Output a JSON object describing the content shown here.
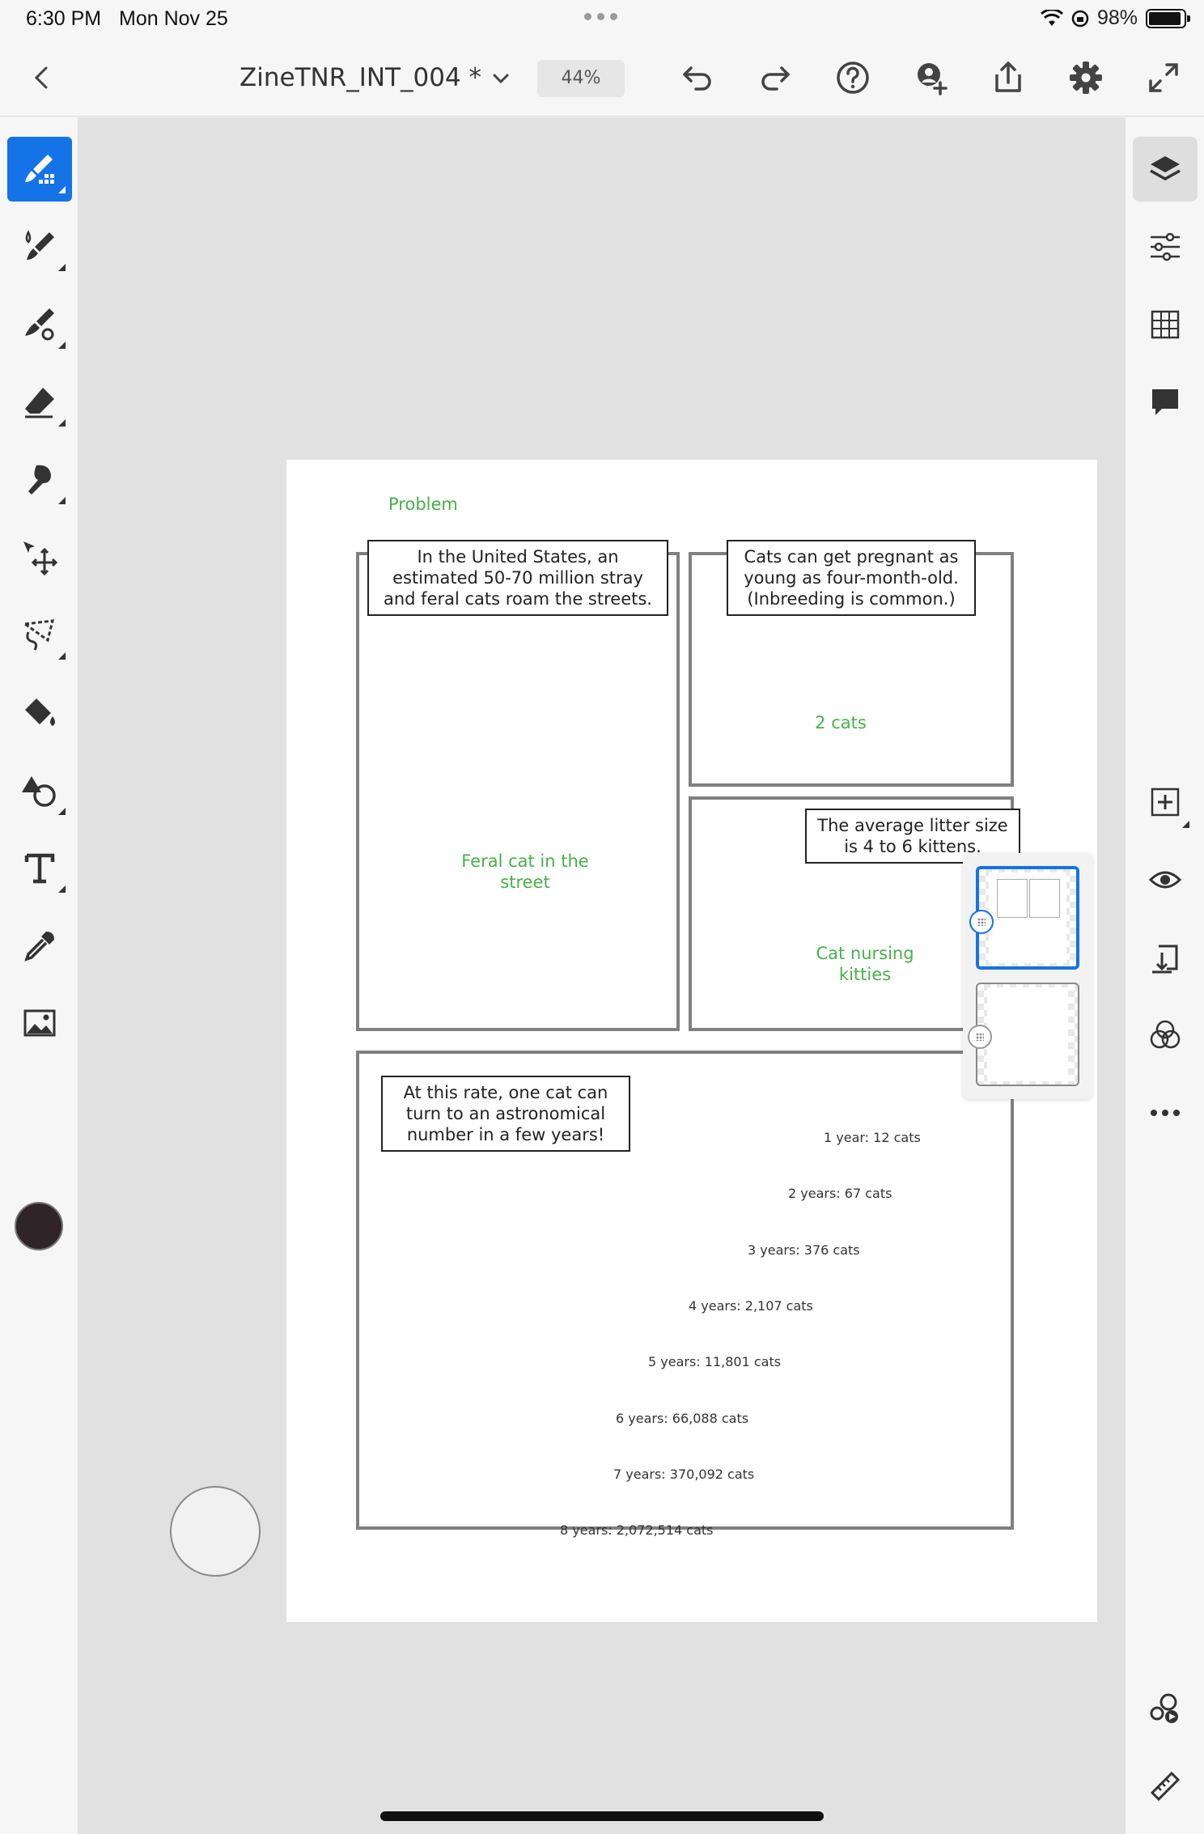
{
  "status": {
    "time": "6:30 PM",
    "date": "Mon Nov 25",
    "battery": "98%"
  },
  "toolbar": {
    "title": "ZineTNR_INT_004 *",
    "zoom": "44%"
  },
  "brush": {
    "size": "40",
    "color": "#2f2528"
  },
  "colors": {
    "accent": "#1473e6",
    "annotation_green": "#47b14a",
    "frame_gray": "#808080"
  },
  "page": {
    "heading": "Problem",
    "panel1": {
      "caption": "In the United States, an estimated 50-70 million stray and feral cats roam the streets.",
      "note": "Feral cat in the street"
    },
    "panel2": {
      "caption": "Cats can get pregnant as young as four-month-old. (Inbreeding is common.)",
      "note": "2 cats"
    },
    "panel3": {
      "caption": "The average litter size is 4 to 6 kittens.",
      "note": "Cat nursing kitties"
    },
    "panel4": {
      "caption": "At this rate, one cat can turn to an astronomical number in a few years!",
      "stats": [
        "1 year: 12 cats",
        "2 years: 67 cats",
        "3 years: 376 cats",
        "4 years: 2,107 cats",
        "5 years: 11,801 cats",
        "6 years: 66,088 cats",
        "7 years: 370,092 cats",
        "8 years: 2,072,514 cats"
      ]
    }
  },
  "icons": {
    "left_tools": [
      "pixel-brush-icon",
      "live-brush-icon",
      "vector-brush-icon",
      "eraser-icon",
      "smudge-icon",
      "transform-icon",
      "lasso-icon",
      "fill-icon",
      "shapes-icon",
      "text-icon",
      "eyedropper-icon",
      "image-icon"
    ],
    "right_tools": [
      "layers-icon",
      "layer-properties-icon",
      "grid-icon",
      "comments-icon",
      "add-layer-icon",
      "visibility-icon",
      "merge-down-icon",
      "blend-icon",
      "more-icon",
      "livestream-icon",
      "ruler-icon"
    ]
  }
}
